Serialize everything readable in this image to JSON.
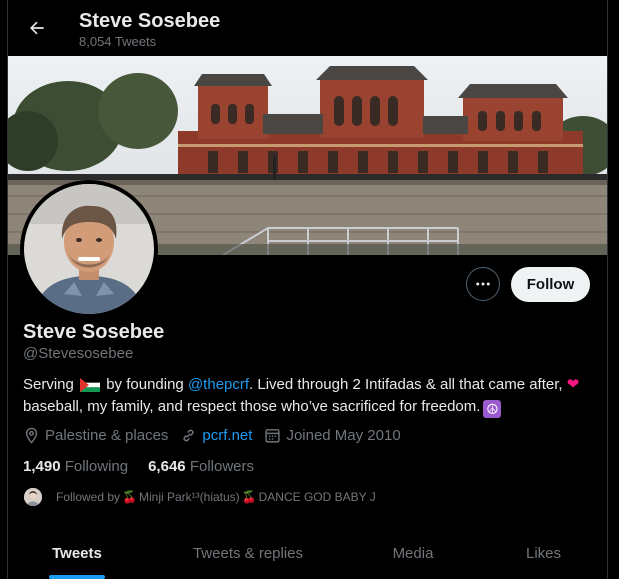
{
  "header": {
    "name": "Steve Sosebee",
    "tweet_count": "8,054 Tweets"
  },
  "actions": {
    "follow_label": "Follow"
  },
  "profile": {
    "name": "Steve Sosebee",
    "handle": "@Stevesosebee",
    "bio": {
      "part1": "Serving",
      "part2": "by founding",
      "mention": "@thepcrf",
      "part3": ". Lived through 2 Intifadas & all that came after,",
      "heart": "❤",
      "part4": "baseball, my family, and respect those who’ve sacrificed for freedom.",
      "peace": "☮"
    },
    "location": "Palestine & places",
    "website": "pcrf.net",
    "joined": "Joined May 2010",
    "following_count": "1,490",
    "following_label": "Following",
    "followers_count": "6,646",
    "followers_label": "Followers",
    "followed_by_prefix": "Followed by",
    "followed_by_1": "Minji Park¹³(hiatus)",
    "followed_by_2": "DANCE GOD BABY J"
  },
  "tabs": [
    {
      "label": "Tweets",
      "active": true
    },
    {
      "label": "Tweets & replies",
      "active": false
    },
    {
      "label": "Media",
      "active": false
    },
    {
      "label": "Likes",
      "active": false
    }
  ],
  "colors": {
    "accent": "#1d9bf0",
    "background": "#000000",
    "secondary_text": "#71767b"
  }
}
